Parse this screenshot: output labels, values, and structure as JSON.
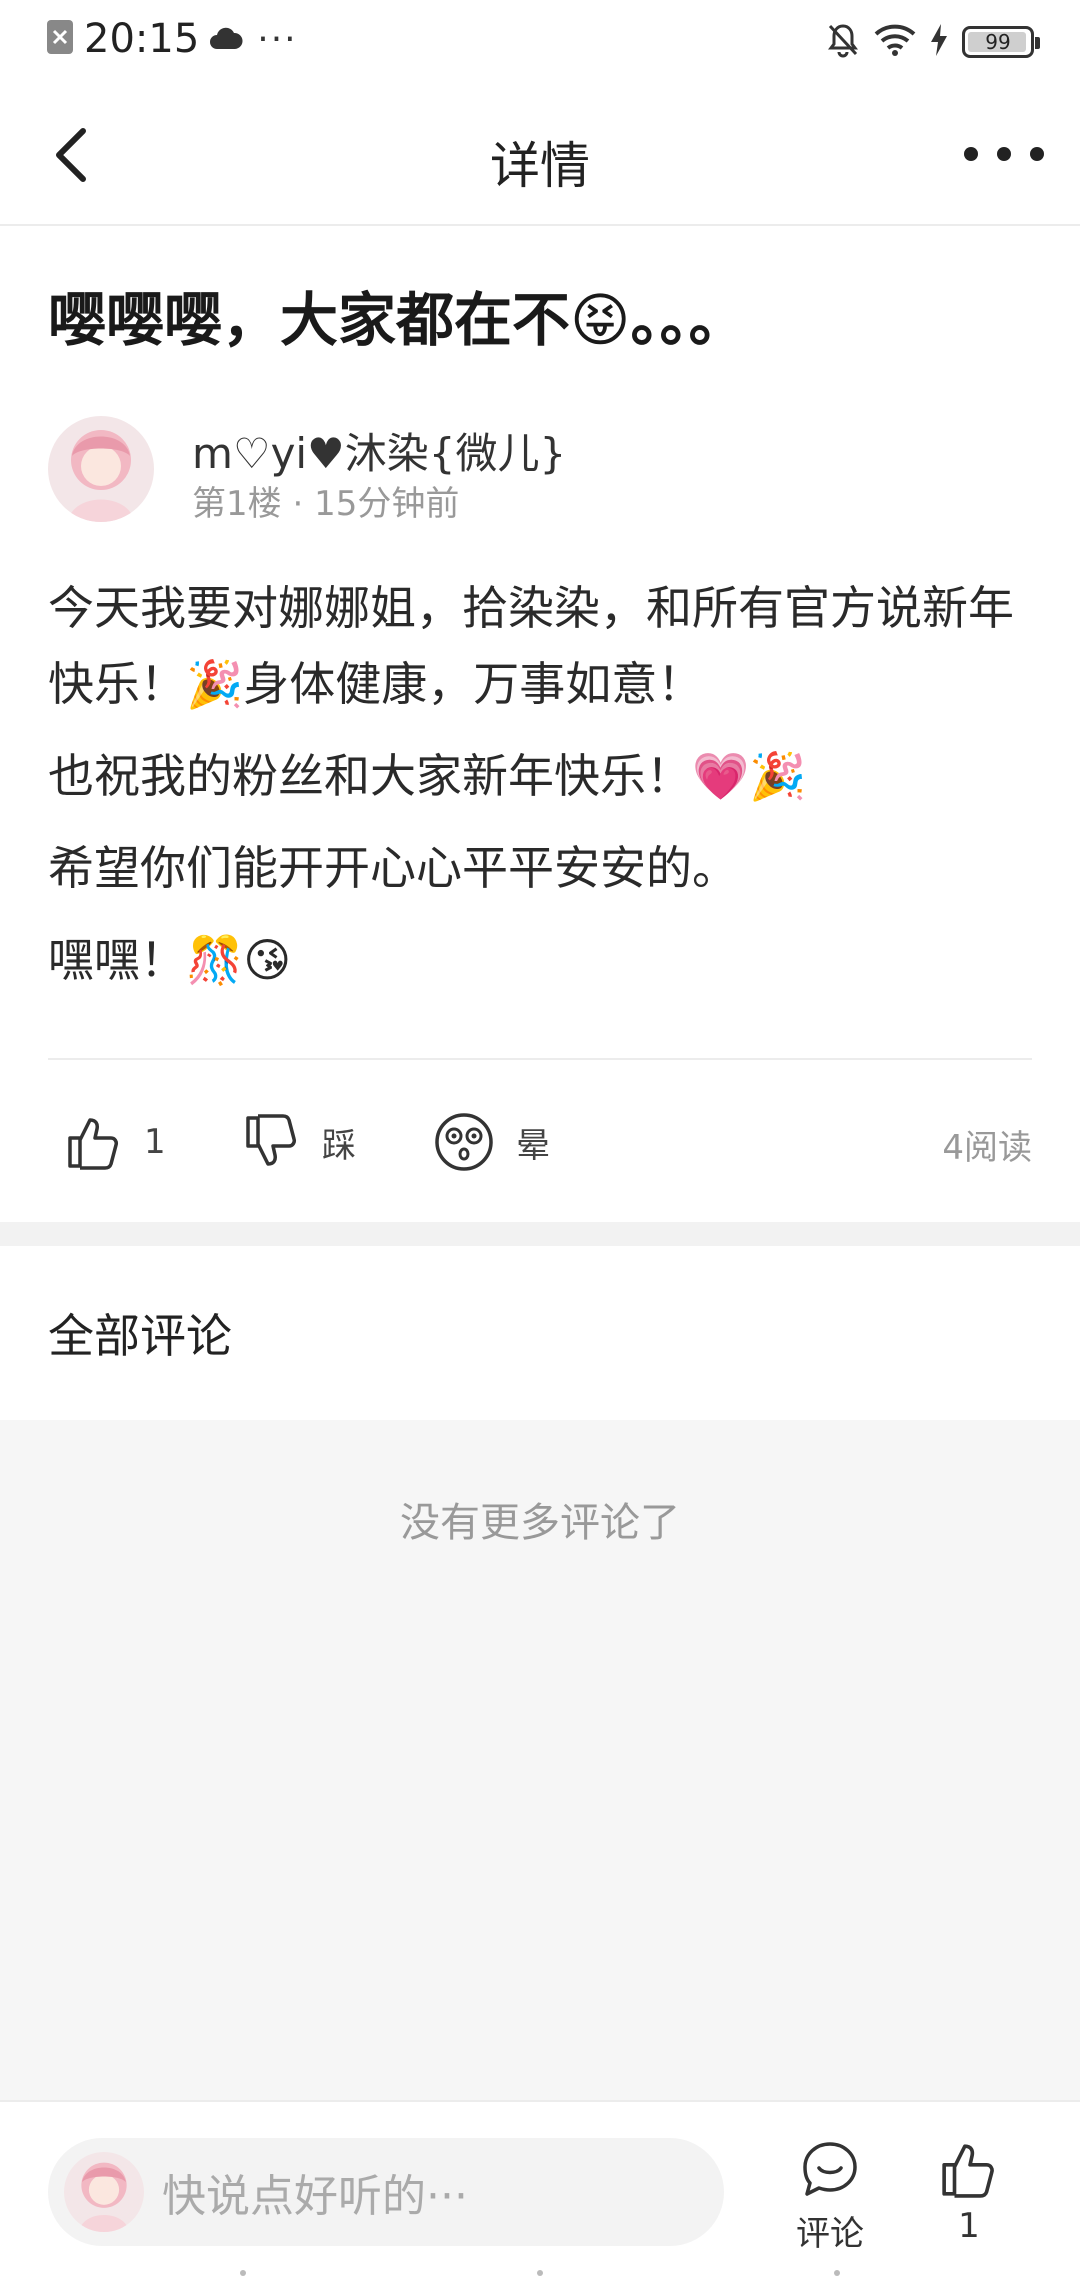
{
  "status_bar": {
    "time": "20:15",
    "more": "···",
    "battery": "99",
    "icons": [
      "sim-icon",
      "cloud-icon",
      "mute-icon",
      "wifi-icon",
      "charging-icon",
      "battery-icon"
    ]
  },
  "nav": {
    "title": "详情"
  },
  "post": {
    "title": "嘤嘤嘤，大家都在不😝。。。",
    "author_name": "m♡yi♥沐染{微儿}",
    "floor": "第1楼",
    "time_ago": "15分钟前",
    "paragraphs": [
      "今天我要对娜娜姐，拾染染，和所有官方说新年快乐！🎉身体健康，万事如意！",
      "也祝我的粉丝和大家新年快乐！💗🎉",
      "希望你们能开开心心平平安安的。",
      "嘿嘿！🎊😘"
    ]
  },
  "actions": {
    "like_count": "1",
    "dislike_label": "踩",
    "dizzy_label": "晕",
    "reads": "4阅读"
  },
  "comments": {
    "header": "全部评论",
    "empty_text": "没有更多评论了"
  },
  "bottom_bar": {
    "input_placeholder": "快说点好听的···",
    "comment_label": "评论",
    "like_count": "1"
  },
  "colors": {
    "background": "#ffffff",
    "comments_bg": "#f6f6f6",
    "muted_text": "#999999",
    "primary_text": "#222222"
  }
}
